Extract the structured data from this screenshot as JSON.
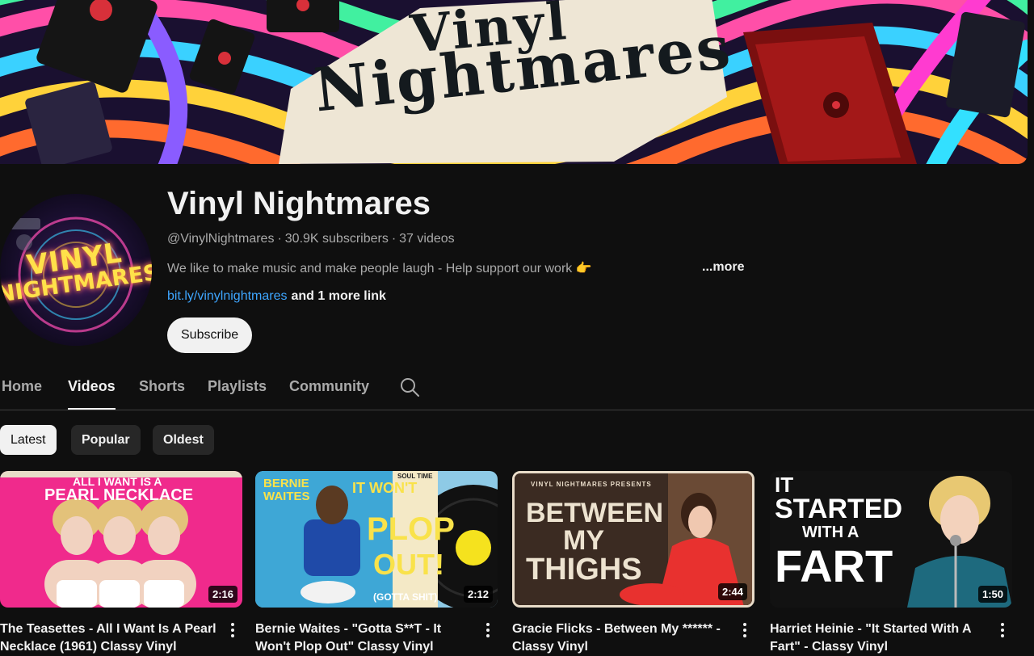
{
  "banner": {
    "line1": "Vinyl",
    "line2": "Nightmares"
  },
  "avatar": {
    "line1": "VINYL",
    "line2": "NIGHTMARES"
  },
  "channel": {
    "name": "Vinyl Nightmares",
    "handle": "@VinylNightmares",
    "separator": "·",
    "subscribers": "30.9K subscribers",
    "videos": "37 videos",
    "description": "We like to make music and make people laugh - Help support our work 👉",
    "more_label": "...more",
    "link": "bit.ly/vinylnightmares",
    "more_links": "and 1 more link",
    "subscribe_label": "Subscribe"
  },
  "tabs": [
    {
      "label": "Home"
    },
    {
      "label": "Videos"
    },
    {
      "label": "Shorts"
    },
    {
      "label": "Playlists"
    },
    {
      "label": "Community"
    }
  ],
  "active_tab": "Videos",
  "filters": [
    {
      "label": "Latest"
    },
    {
      "label": "Popular"
    },
    {
      "label": "Oldest"
    }
  ],
  "active_filter": "Latest",
  "videos": [
    {
      "title": "The Teasettes - All I Want Is A Pearl Necklace (1961) Classy Vinyl",
      "duration": "2:16",
      "thumb_line1": "ALL I WANT IS A",
      "thumb_line2": "PEARL NECKLACE"
    },
    {
      "title": "Bernie Waites - \"Gotta S**T - It Won't Plop Out\" Classy Vinyl",
      "duration": "2:12",
      "thumb_artist1": "BERNIE",
      "thumb_artist2": "WAITES",
      "thumb_label": "SOUL TIME",
      "thumb_line1": "IT WON'T",
      "thumb_line2": "PLOP",
      "thumb_line3": "OUT!",
      "thumb_line4": "(GOTTA SHIT)"
    },
    {
      "title": "Gracie Flicks - Between My ****** - Classy Vinyl",
      "duration": "2:44",
      "thumb_top": "VINYL NIGHTMARES PRESENTS",
      "thumb_line1": "BETWEEN",
      "thumb_line2": "MY",
      "thumb_line3": "THIGHS"
    },
    {
      "title": "Harriet Heinie - \"It Started With A Fart\" - Classy Vinyl",
      "duration": "1:50",
      "thumb_line1": "IT",
      "thumb_line2": "STARTED",
      "thumb_line3": "WITH A",
      "thumb_line4": "FART"
    }
  ],
  "colors": {
    "background": "#0f0f0f",
    "text_primary": "#f1f1f1",
    "text_secondary": "#aaaaaa",
    "link": "#3ea6ff",
    "chip_bg": "#272727"
  }
}
